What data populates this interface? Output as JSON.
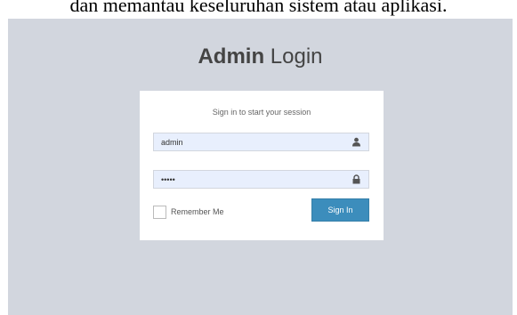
{
  "caption": "dan memantau keseluruhan sistem atau aplikasi.",
  "logo": {
    "bold": "Admin",
    "light": "Login"
  },
  "login_box": {
    "message": "Sign in to start your session",
    "username": {
      "value": "admin",
      "icon": "user-icon"
    },
    "password": {
      "value": "•••••",
      "icon": "lock-icon"
    },
    "remember_label": "Remember Me",
    "remember_checked": false,
    "submit_label": "Sign In"
  },
  "colors": {
    "background": "#d2d6de",
    "box": "#ffffff",
    "button": "#3c8dbc",
    "input_bg": "#e8effd"
  }
}
